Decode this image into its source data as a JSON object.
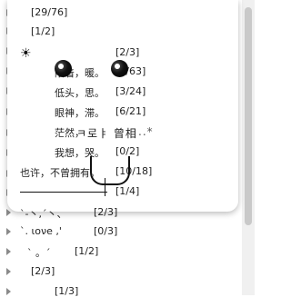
{
  "card_rows": [
    {
      "text": "[29/76]"
    },
    {
      "text": "[1/2]"
    },
    {
      "text": "[2/3]"
    },
    {
      "text": "陪着，暖。"
    },
    {
      "text": "[2/63]"
    },
    {
      "text": "低头，思。"
    },
    {
      "text": "[3/24]"
    },
    {
      "text": "眼神，滞。"
    },
    {
      "text": "[6/21]"
    },
    {
      "text": "茫然，"
    },
    {
      "text": "我想，哭。"
    },
    {
      "text": "[0/2]"
    },
    {
      "text": "也许，不曾拥有。"
    },
    {
      "text": "[10/18]"
    },
    {
      "text": "[1/4]"
    }
  ],
  "overlay": {
    "face_text": "ㅋ로ㅑ 曾相",
    "dots": "..*",
    "sun": "☀"
  },
  "list_rows": [
    {
      "text": "ˋ-丶,ˊ丶、"
    },
    {
      "text": "[2/3]"
    },
    {
      "text": "`. ιονe ,'"
    },
    {
      "text": "[0/3]"
    },
    {
      "text": "`  。ˊ"
    },
    {
      "text": "[1/2]"
    },
    {
      "text": "[2/3]"
    },
    {
      "text": "[1/3]"
    }
  ]
}
